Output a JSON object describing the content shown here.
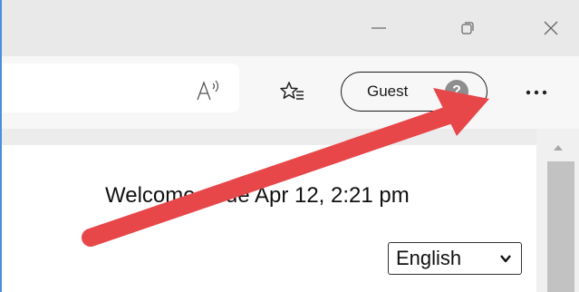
{
  "window": {
    "minimize_icon": "minimize-icon",
    "restore_icon": "restore-icon",
    "close_icon": "close-icon"
  },
  "toolbar": {
    "read_aloud_icon": "read-aloud-icon",
    "favorites_icon": "favorites-icon",
    "profile": {
      "label": "Guest",
      "avatar_glyph": "?"
    },
    "more_icon": "more-icon"
  },
  "page": {
    "welcome_text": "Welcome , Tue Apr 12, 2:21 pm",
    "language": {
      "selected": "English"
    }
  },
  "annotation": {
    "arrow_color": "#e8474a"
  },
  "colors": {
    "titlebar": "#e9e9ea",
    "toolbar": "#f7f7f7",
    "avatar": "#8e8e8e",
    "scroll_thumb": "#c2c2c2"
  }
}
